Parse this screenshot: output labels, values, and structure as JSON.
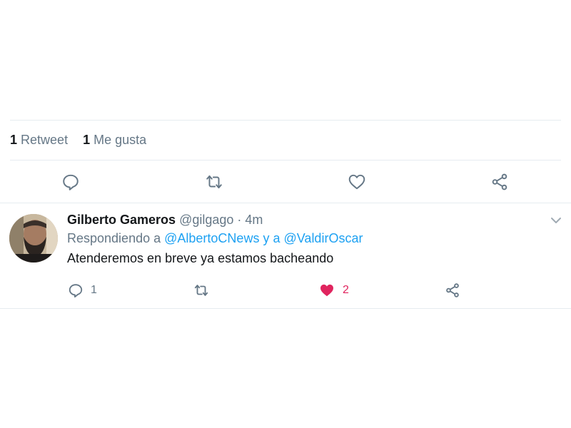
{
  "colors": {
    "icon_gray": "#657786",
    "link_blue": "#1da1f2",
    "like_red": "#e0245e",
    "divider": "#e6ecf0",
    "text_dark": "#14171a"
  },
  "main_tweet": {
    "retweet_count": "1",
    "retweet_label": "Retweet",
    "like_count": "1",
    "like_label": "Me gusta",
    "actions": {
      "reply_icon": "reply-icon",
      "retweet_icon": "retweet-icon",
      "like_icon": "heart-icon",
      "share_icon": "share-icon"
    }
  },
  "reply": {
    "display_name": "Gilberto Gameros",
    "handle": "@gilgago",
    "separator": "·",
    "time": "4m",
    "replying_prefix": "Respondiendo a",
    "mention_1": "@AlbertoCNews",
    "conjunction": "y a",
    "mention_2": "@ValdirOscar",
    "text": "Atenderemos en breve ya estamos bacheando",
    "reply_count": "1",
    "like_count": "2",
    "liked": true
  }
}
